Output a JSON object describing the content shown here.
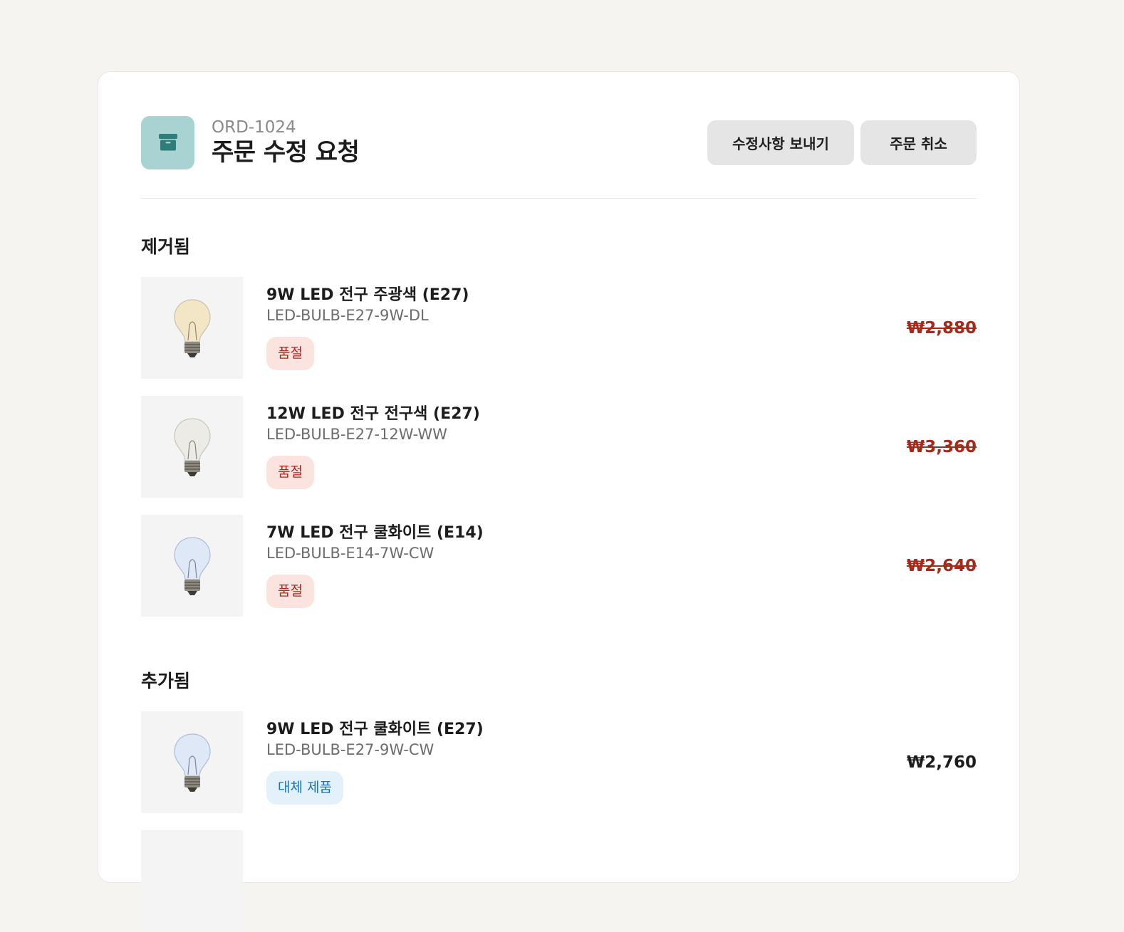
{
  "header": {
    "order_id": "ORD-1024",
    "title": "주문 수정 요청",
    "icon": "package-icon",
    "send_label": "수정사항 보내기",
    "cancel_label": "주문 취소"
  },
  "removed": {
    "title": "제거됨",
    "items": [
      {
        "name": "9W LED 전구 주광색 (E27)",
        "sku": "LED-BULB-E27-9W-DL",
        "badge": "품절",
        "price": "₩2,880",
        "bulb_color": "#f2e6c6"
      },
      {
        "name": "12W LED 전구 전구색 (E27)",
        "sku": "LED-BULB-E27-12W-WW",
        "badge": "품절",
        "price": "₩3,360",
        "bulb_color": "#ecebe6"
      },
      {
        "name": "7W LED 전구 쿨화이트 (E14)",
        "sku": "LED-BULB-E14-7W-CW",
        "badge": "품절",
        "price": "₩2,640",
        "bulb_color": "#dfe8f7"
      }
    ]
  },
  "added": {
    "title": "추가됨",
    "items": [
      {
        "name": "9W LED 전구 쿨화이트 (E27)",
        "sku": "LED-BULB-E27-9W-CW",
        "badge": "대체 제품",
        "price": "₩2,760",
        "bulb_color": "#dfe8f7"
      }
    ]
  },
  "colors": {
    "accent_tile": "#a9d3d2",
    "accent_icon": "#2f7d7b",
    "removed_price": "#a52a1a",
    "out_of_stock_bg": "#fbe3e0",
    "substitute_bg": "#e3f1fb"
  }
}
